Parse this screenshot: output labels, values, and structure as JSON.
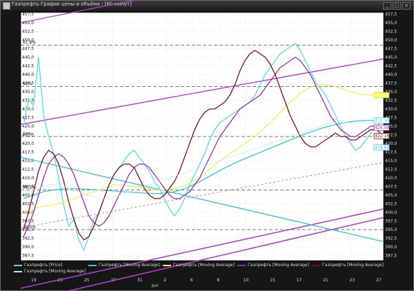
{
  "window": {
    "title": "Газпрефть График цены и объёма - [60 минут]",
    "buttons": [
      "_",
      "□",
      "×"
    ]
  },
  "colors": {
    "plot_bg": "#ffffff",
    "grid": "#c8c8c8",
    "price": "#5ad8e8",
    "ma_cyan": "#35c9d9",
    "ma_yellow": "#f0f05a",
    "ma_purple": "#9a2aa8",
    "ma_brown": "#7a1010",
    "channel": "#b040c8",
    "cyan_trend": "#40c0d8",
    "fib_line": "#777777"
  },
  "fib_labels": [
    "61.8%",
    "50%",
    "50%",
    "38.2%",
    "38.2%"
  ],
  "price_tags": [
    "426.66",
    "424.56",
    "422.16",
    "418.82"
  ],
  "chart_data": {
    "type": "line",
    "title": "Газпрефть График цены и объёма - [60 минут]",
    "xlabel": "",
    "ylabel": "",
    "ylim": [
      386,
      458
    ],
    "y_ticks": [
      387.5,
      390.0,
      392.5,
      395.0,
      397.5,
      400.0,
      402.5,
      405.0,
      407.5,
      410.0,
      412.5,
      415.0,
      417.5,
      420.0,
      422.5,
      425.0,
      427.5,
      430.0,
      432.5,
      435.0,
      437.5,
      440.0,
      442.5,
      445.0,
      447.5,
      450.0,
      452.5,
      455.0,
      457.5
    ],
    "x_ticks": [
      "19",
      "23",
      "25",
      "27",
      "31",
      "2",
      "6",
      "8",
      "10",
      "15",
      "17",
      "21",
      "23",
      "27"
    ],
    "x_sublabel": "Jun",
    "grid": true,
    "legend": [
      "Газпрефть [Price]",
      "Газпрефть [Moving Average]",
      "Газпрефть [Moving Average]",
      "Газпрефть [Moving Average]",
      "Газпрефть [Moving Average]",
      "Газпрефть [Moving Average]"
    ],
    "series": [
      {
        "name": "Газпрефть [Price]",
        "color": "#5ad8e8",
        "values": [
          425,
          433,
          431,
          445,
          428,
          422,
          417,
          410,
          402,
          396,
          398,
          392,
          389,
          393,
          398,
          400,
          404,
          408,
          411,
          413,
          415,
          417,
          418,
          416,
          414,
          412,
          409,
          407,
          404,
          401,
          399,
          401,
          404,
          408,
          411,
          414,
          417,
          421,
          424,
          426,
          427,
          428,
          429,
          430,
          431,
          432,
          434,
          437,
          440,
          442,
          444,
          446,
          447,
          448,
          449,
          447,
          444,
          441,
          438,
          436,
          434,
          431,
          428,
          425,
          422,
          420,
          418,
          419,
          421,
          423,
          425,
          426
        ]
      },
      {
        "name": "Газпрефть [Moving Average]",
        "color": "#35c9d9",
        "values": [
          404,
          404.5,
          405,
          405.5,
          406,
          406.3,
          406.5,
          406.7,
          406.8,
          406.9,
          406.9,
          406.9,
          406.8,
          406.7,
          406.6,
          406.5,
          406.4,
          406.3,
          406.2,
          406.1,
          406,
          405.9,
          405.8,
          405.7,
          405.6,
          405.5,
          405.5,
          405.5,
          405.6,
          405.8,
          406,
          406.4,
          406.9,
          407.5,
          408.2,
          408.9,
          409.7,
          410.5,
          411.3,
          412.1,
          412.9,
          413.6,
          414.3,
          415,
          415.6,
          416.2,
          416.8,
          417.4,
          418,
          418.6,
          419.2,
          419.8,
          420.4,
          421,
          421.6,
          422.2,
          422.8,
          423.3,
          423.8,
          424.3,
          424.7,
          425.1,
          425.5,
          425.8,
          426.1,
          426.3,
          426.5,
          426.6,
          426.7,
          426.7,
          426.7,
          426.7
        ]
      },
      {
        "name": "Газпрефть [Moving Average]",
        "color": "#f0f05a",
        "values": [
          400,
          400.5,
          401,
          401.5,
          401.8,
          402,
          402.2,
          402.5,
          403,
          403.5,
          404,
          404.5,
          405,
          405.5,
          406,
          406.5,
          407,
          407.5,
          408,
          408,
          408,
          407.8,
          407.5,
          407.3,
          407,
          406.8,
          406.6,
          406.5,
          406.5,
          406.6,
          406.9,
          407.3,
          407.8,
          408.5,
          409.3,
          410.2,
          411.3,
          412.5,
          413.7,
          414.9,
          416,
          417,
          418,
          419,
          420,
          421,
          422,
          423.3,
          424.7,
          426,
          427.5,
          429,
          430.5,
          432,
          433.3,
          434.5,
          435.5,
          436.3,
          436.8,
          437,
          437,
          436.8,
          436.5,
          436,
          435.5,
          435,
          434.6,
          434.3,
          434.1,
          434,
          434,
          434
        ]
      },
      {
        "name": "Газпрефть [Moving Average]",
        "color": "#9a2aa8",
        "values": [
          393,
          396,
          400,
          405,
          410,
          414,
          416,
          417,
          416,
          414,
          411,
          407,
          403,
          399,
          397,
          396,
          397,
          399,
          402,
          405,
          408,
          411,
          413,
          414,
          414,
          413,
          411,
          409,
          407,
          405,
          404,
          404,
          405,
          406,
          408,
          410,
          413,
          416,
          419,
          422,
          424,
          426,
          428,
          430,
          431,
          432,
          433,
          434,
          436,
          438,
          440,
          442,
          443,
          444,
          445,
          444,
          442,
          440,
          437,
          434,
          431,
          428,
          426,
          424,
          423,
          422,
          422,
          423,
          424,
          425,
          425,
          424
        ]
      },
      {
        "name": "Газпрефть [Moving Average]",
        "color": "#7a1010",
        "values": [
          395,
          400,
          406,
          412,
          416,
          418,
          417,
          414,
          409,
          403,
          398,
          394,
          392,
          393,
          396,
          400,
          404,
          408,
          411,
          413,
          414,
          414,
          413,
          410,
          407,
          405,
          404,
          404,
          405,
          407,
          409,
          412,
          416,
          420,
          424,
          427,
          429,
          430,
          430,
          431,
          432,
          434,
          437,
          441,
          444,
          446,
          447,
          446,
          445,
          443,
          440,
          436,
          432,
          428,
          425,
          422,
          420,
          419,
          419,
          420,
          421,
          422,
          423,
          422,
          422,
          421,
          421,
          422,
          423,
          424,
          424,
          423
        ]
      },
      {
        "name": "Газпрефть [Moving Average]",
        "color": "#b8eef5",
        "values": [
          406,
          406,
          406.5,
          407,
          407.5,
          408,
          408,
          408,
          407.5,
          407,
          406.5,
          406,
          405.5,
          405,
          404.5,
          404,
          404,
          404,
          404.5,
          405,
          405.5,
          406,
          406.5,
          407,
          407.5,
          408,
          408.5,
          409,
          409.5,
          410,
          410.5,
          411,
          411.5,
          412,
          412.5,
          413,
          413.5,
          414,
          414.5,
          415,
          415.5,
          416,
          416.5,
          417,
          417.5,
          418,
          418.5,
          419,
          419.5,
          420,
          420.5,
          421,
          421.5,
          422,
          422.5,
          423,
          423.5,
          424,
          424.5,
          425,
          425.5,
          426,
          426,
          426,
          426,
          426,
          426,
          426,
          426,
          426,
          426,
          426
        ]
      }
    ],
    "fib_levels": [
      448.5,
      436.5,
      422.0,
      406.5,
      395.0
    ]
  }
}
